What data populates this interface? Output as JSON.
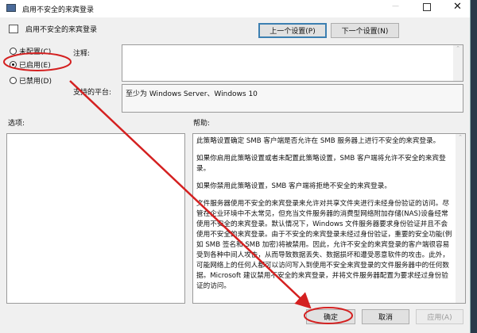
{
  "window": {
    "title": "启用不安全的来宾登录"
  },
  "header": {
    "setting_name": "启用不安全的来宾登录",
    "prev_button": "上一个设置(P)",
    "next_button": "下一个设置(N)"
  },
  "state": {
    "options": [
      {
        "label": "未配置(C)",
        "selected": false
      },
      {
        "label": "已启用(E)",
        "selected": true
      },
      {
        "label": "已禁用(D)",
        "selected": false
      }
    ]
  },
  "comment": {
    "label": "注释:",
    "value": ""
  },
  "platform": {
    "label": "支持的平台:",
    "value": "至少为 Windows Server、Windows 10"
  },
  "options_label": "选项:",
  "help": {
    "label": "帮助:",
    "paragraphs": [
      "此策略设置确定 SMB 客户端是否允许在 SMB 服务器上进行不安全的来宾登录。",
      "如果你启用此策略设置或者未配置此策略设置，SMB 客户端将允许不安全的来宾登录。",
      "如果你禁用此策略设置，SMB 客户端将拒绝不安全的来宾登录。",
      "文件服务器使用不安全的来宾登录来允许对共享文件夹进行未经身份验证的访问。尽管在企业环境中不太常见，但充当文件服务器的消费型网络附加存储(NAS)设备经常使用不安全的来宾登录。默认情况下，Windows 文件服务器要求身份验证并且不会使用不安全的来宾登录。由于不安全的来宾登录未经过身份验证，重要的安全功能(例如 SMB 签名和 SMB 加密)将被禁用。因此，允许不安全的来宾登录的客户端很容易受到各种中间人攻击，从而导致数据丢失、数据损坏和遭受恶意软件的攻击。此外，可能网络上的任何人都可以访问写入到使用不安全来宾登录的文件服务器中的任何数据。Microsoft 建议禁用不安全的来宾登录，并将文件服务器配置为要求经过身份验证的访问。"
    ]
  },
  "footer": {
    "ok": "确定",
    "cancel": "取消",
    "apply": "应用(A)"
  },
  "annotation_color": "#d42020"
}
